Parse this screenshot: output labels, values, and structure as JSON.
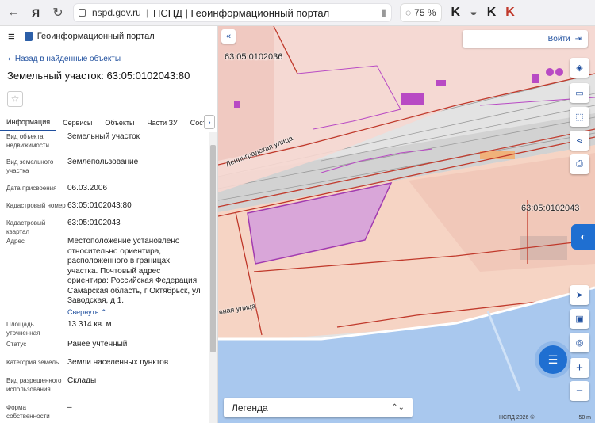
{
  "browser": {
    "back_icon": "back-arrow-icon",
    "ya_label": "Я",
    "url": "nspd.gov.ru",
    "tab_title": "НСПД | Геоинформационный портал",
    "zoom": "75 %"
  },
  "panel": {
    "portal_title": "Геоинформационный портал",
    "back_link": "Назад в найденные объекты",
    "object_title": "Земельный участок: 63:05:0102043:80",
    "tabs": [
      "Информация",
      "Сервисы",
      "Объекты",
      "Части ЗУ",
      "Состав"
    ],
    "rows": [
      {
        "label": "Вид объекта недвижимости",
        "value": "Земельный участок"
      },
      {
        "label": "Вид земельного участка",
        "value": "Землепользование"
      },
      {
        "label": "Дата присвоения",
        "value": "06.03.2006"
      },
      {
        "label": "Кадастровый номер",
        "value": "63:05:0102043:80"
      },
      {
        "label": "Кадастровый квартал",
        "value": "63:05:0102043"
      },
      {
        "label": "Адрес",
        "value": "Местоположение установлено относительно ориентира, расположенного в границах участка. Почтовый адрес ориентира: Российская Федерация, Самарская область, г Октябрьск, ул Заводская, д 1."
      },
      {
        "label": "Площадь уточненная",
        "value": "13 314 кв. м"
      },
      {
        "label": "Статус",
        "value": "Ранее учтенный"
      },
      {
        "label": "Категория земель",
        "value": "Земли населенных пунктов"
      },
      {
        "label": "Вид разрешенного использования",
        "value": "Склады"
      },
      {
        "label": "Форма собственности",
        "value": "–"
      }
    ],
    "collapse_link": "Свернуть"
  },
  "map": {
    "login": "Войти",
    "legend": "Легенда",
    "copyright": "НСПД 2026 ©",
    "scale": "50 m",
    "labels": {
      "quarter_north": "63:05:0102036",
      "quarter_main": "63:05:0102043",
      "street_leningradskaya": "Ленинградская улица",
      "street_zavodskaya": "вная улица"
    },
    "colors": {
      "parcel_border": "#c0392b",
      "selected_fill": "#d9a6d9",
      "water": "#a9c8ee",
      "accent": "#1f6fd1"
    }
  }
}
